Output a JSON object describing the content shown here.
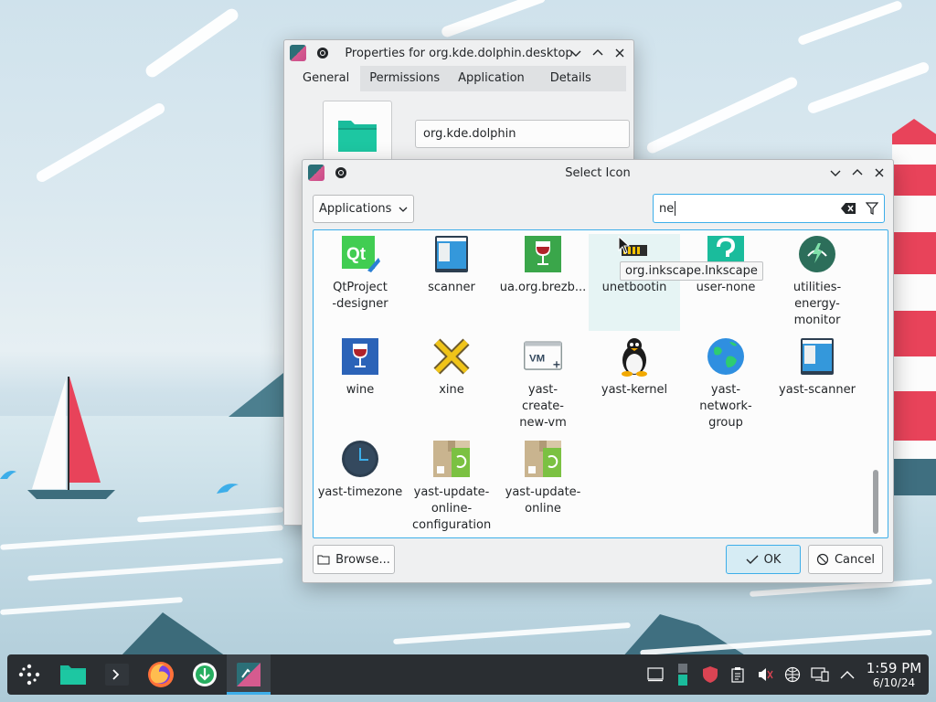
{
  "properties_window": {
    "title": "Properties for org.kde.dolphin.desktop",
    "tabs": [
      "General",
      "Permissions",
      "Application",
      "Details"
    ],
    "name_value": "org.kde.dolphin"
  },
  "select_icon_dialog": {
    "title": "Select Icon",
    "category_combo": "Applications",
    "search_value": "ne",
    "tooltip": "org.inkscape.Inkscape",
    "icons": [
      {
        "label": "QtProject-designer",
        "icon": "qt-designer-icon"
      },
      {
        "label": "scanner",
        "icon": "scanner-icon"
      },
      {
        "label": "ua.org.brezb...",
        "icon": "wine-glass-green-icon"
      },
      {
        "label": "unetbootin",
        "icon": "unetbootin-icon"
      },
      {
        "label": "user-none",
        "icon": "question-mark-icon"
      },
      {
        "label": "utilities-energy-monitor",
        "icon": "energy-monitor-icon"
      },
      {
        "label": "wine",
        "icon": "wine-icon"
      },
      {
        "label": "xine",
        "icon": "xine-icon"
      },
      {
        "label": "yast-create-new-vm",
        "icon": "vm-create-icon"
      },
      {
        "label": "yast-kernel",
        "icon": "tux-icon"
      },
      {
        "label": "yast-network-group",
        "icon": "globe-icon"
      },
      {
        "label": "yast-scanner",
        "icon": "scanner-icon"
      },
      {
        "label": "yast-timezone",
        "icon": "clock-icon"
      },
      {
        "label": "yast-update-online-configuration",
        "icon": "package-update-icon"
      },
      {
        "label": "yast-update-online",
        "icon": "package-update-icon"
      }
    ],
    "browse_label": "Browse...",
    "ok_label": "OK",
    "cancel_label": "Cancel"
  },
  "taskbar": {
    "apps": [
      "application-launcher",
      "dolphin-file-manager",
      "konsole-terminal",
      "firefox-browser",
      "software-updater",
      "desktop-file-editor"
    ],
    "clock_time": "1:59 PM",
    "clock_date": "6/10/24"
  },
  "colors": {
    "accent": "#3daee9",
    "window_bg": "#eff0f1",
    "panel_bg": "#2a2e32"
  }
}
